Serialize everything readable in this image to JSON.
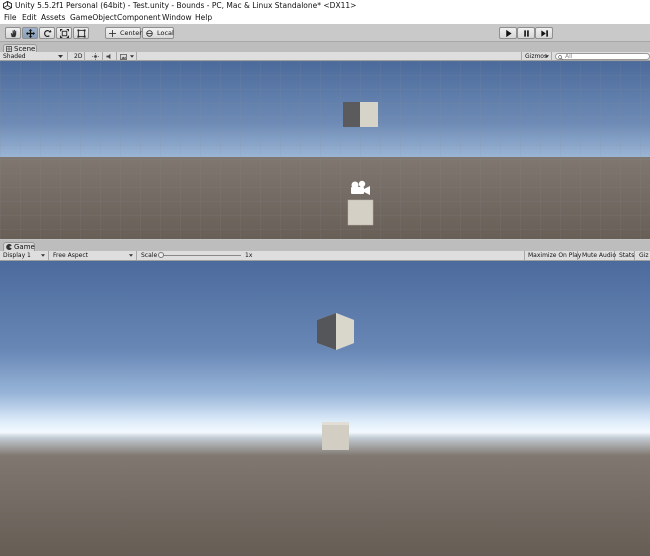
{
  "window": {
    "title": "Unity 5.5.2f1 Personal (64bit) - Test.unity - Bounds - PC, Mac & Linux Standalone* <DX11>"
  },
  "menu": {
    "items": [
      {
        "label": "File"
      },
      {
        "label": "Edit"
      },
      {
        "label": "Assets"
      },
      {
        "label": "GameObject"
      },
      {
        "label": "Component"
      },
      {
        "label": "Window"
      },
      {
        "label": "Help"
      }
    ]
  },
  "toolbar": {
    "tools": [
      "hand-tool",
      "move-tool",
      "rotate-tool",
      "scale-tool",
      "rect-tool"
    ],
    "active_tool": "move-tool",
    "pivot_label": "Center",
    "space_label": "Local",
    "playback": [
      "play",
      "pause",
      "step"
    ]
  },
  "scene": {
    "tab_label": "Scene",
    "shading_label": "Shaded",
    "mode_2d_label": "2D",
    "gizmos_label": "Gizmos",
    "search_placeholder": "All"
  },
  "game": {
    "tab_label": "Game",
    "display_label": "Display 1",
    "aspect_label": "Free Aspect",
    "scale_label": "Scale",
    "scale_value": "1x",
    "maximize_label": "Maximize On Play",
    "mute_label": "Mute Audio",
    "stats_label": "Stats",
    "gizmos_label": "Giz"
  },
  "colors": {
    "sky_top": "#4a6a9c",
    "horizon": "#e8f2fc",
    "ground": "#6b6258",
    "active_tool": "#8aa0bb"
  }
}
